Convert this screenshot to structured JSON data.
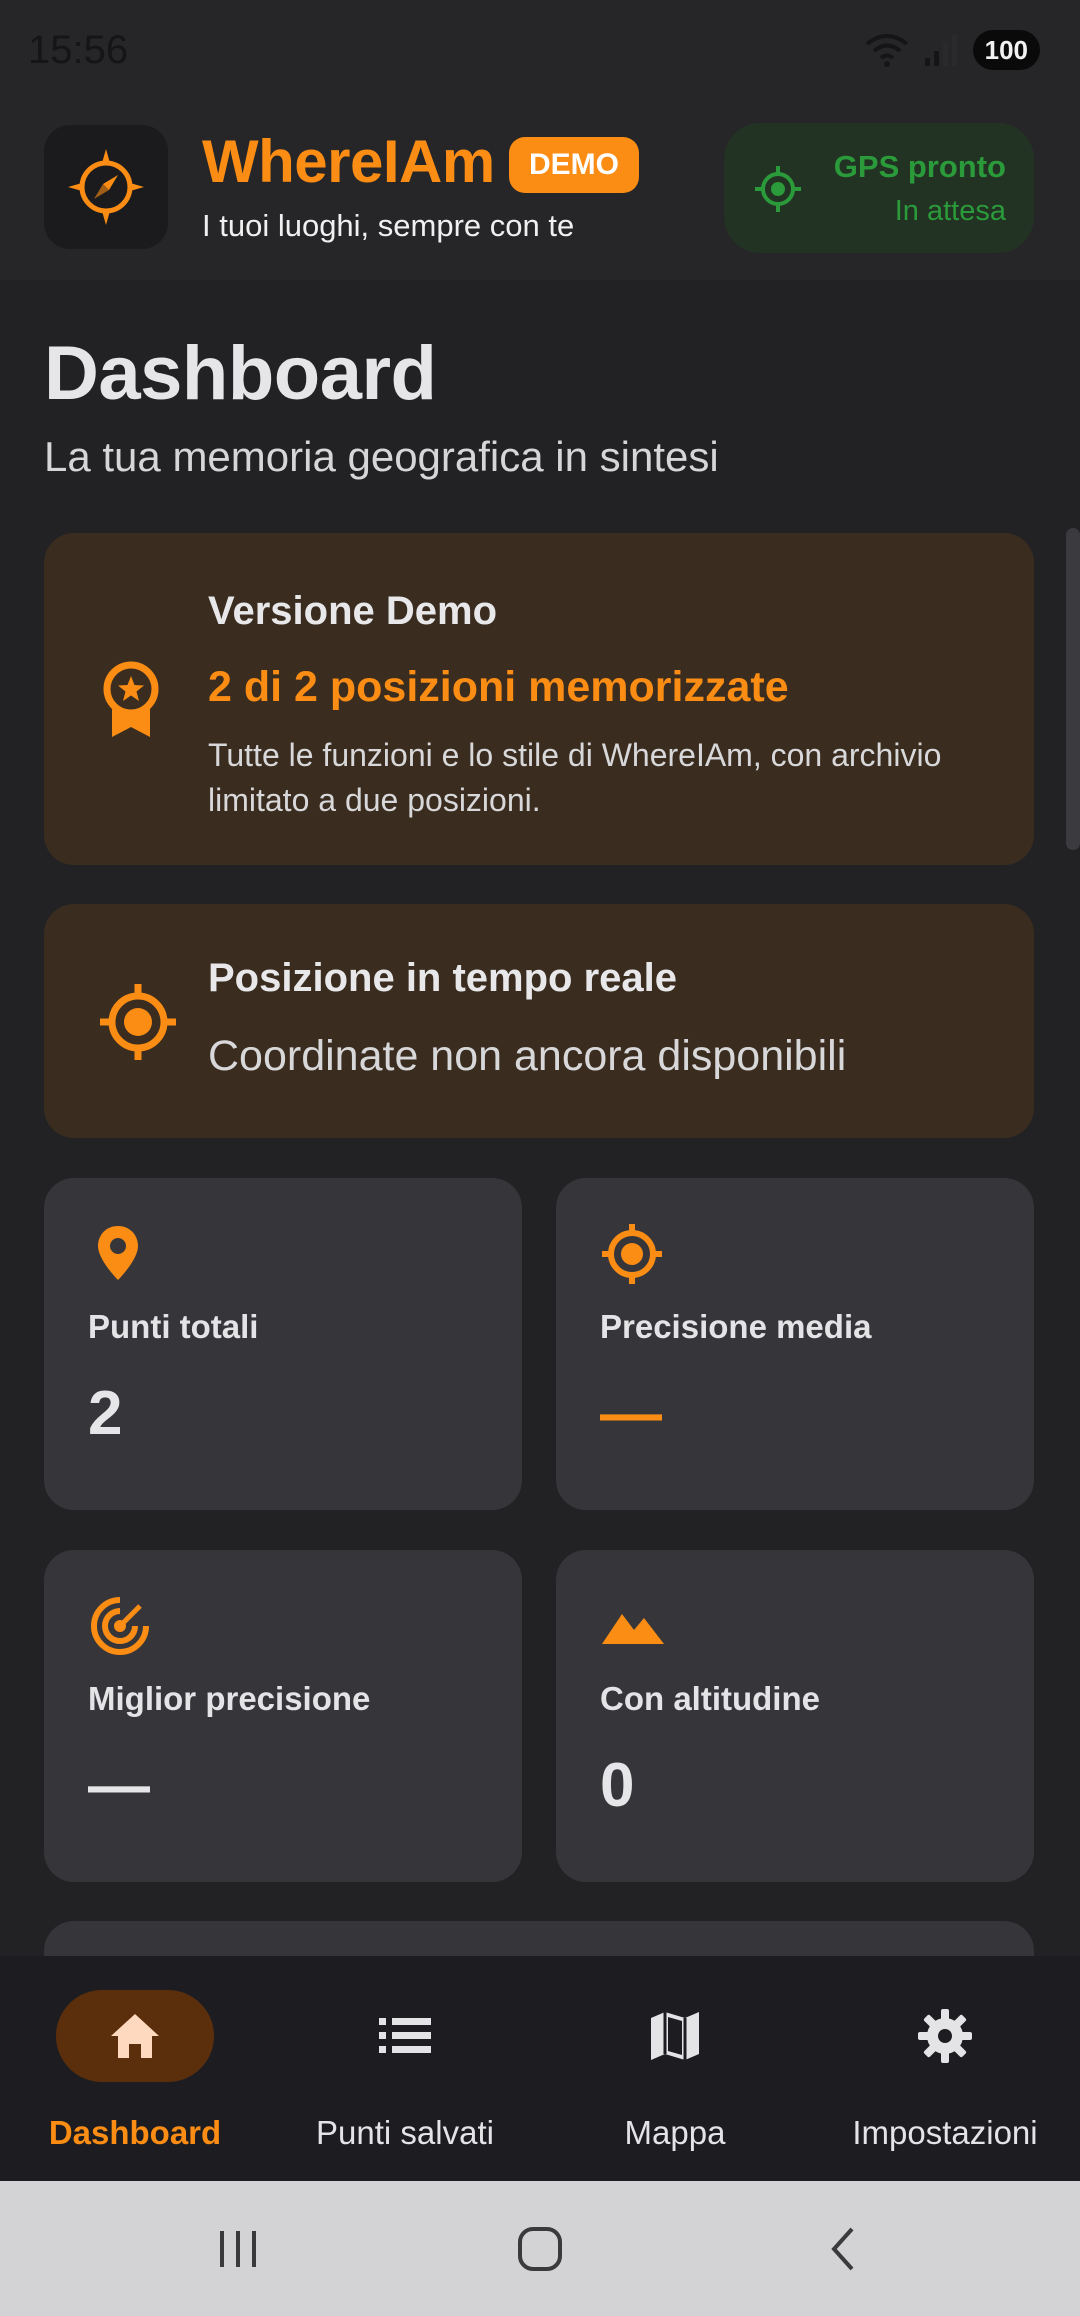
{
  "status_bar": {
    "time": "15:56",
    "battery": "100",
    "icons": [
      "wifi-icon",
      "signal-icon",
      "battery-icon"
    ]
  },
  "header": {
    "app_name": "WhereIAm",
    "badge": "DEMO",
    "tagline": "I tuoi luoghi, sempre con te",
    "gps_status_title": "GPS pronto",
    "gps_status_sub": "In attesa"
  },
  "page": {
    "title": "Dashboard",
    "subtitle": "La tua memoria geografica in sintesi"
  },
  "demo_card": {
    "title": "Versione Demo",
    "count": "2 di 2 posizioni memorizzate",
    "description": "Tutte le funzioni e lo stile di WhereIAm, con archivio limitato a due posizioni."
  },
  "live_card": {
    "title": "Posizione in tempo reale",
    "description": "Coordinate non ancora disponibili"
  },
  "stats": [
    {
      "label": "Punti totali",
      "value": "2",
      "icon": "pin-icon"
    },
    {
      "label": "Precisione media",
      "value": "—",
      "icon": "target-icon"
    },
    {
      "label": "Miglior precisione",
      "value": "—",
      "icon": "radar-icon"
    },
    {
      "label": "Con altitudine",
      "value": "0",
      "icon": "mountain-icon"
    }
  ],
  "nav": [
    {
      "label": "Dashboard",
      "icon": "home-icon",
      "active": true
    },
    {
      "label": "Punti salvati",
      "icon": "list-icon",
      "active": false
    },
    {
      "label": "Mappa",
      "icon": "map-icon",
      "active": false
    },
    {
      "label": "Impostazioni",
      "icon": "settings-icon",
      "active": false
    }
  ],
  "colors": {
    "accent": "#fb8c14",
    "gps_green": "#2b9a3a",
    "background": "#222224",
    "card": "#36363a",
    "warm_card": "#3a2d1f"
  }
}
